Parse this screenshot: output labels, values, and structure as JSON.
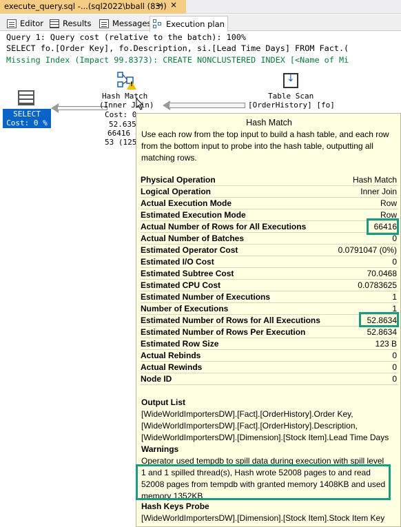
{
  "doc_tab": {
    "title": "execute_query.sql -...(sql2022\\bball (83))",
    "pin": "⊸",
    "close": "×"
  },
  "result_tabs": [
    {
      "label": "Editor"
    },
    {
      "label": "Results"
    },
    {
      "label": "Messages"
    },
    {
      "label": "Execution plan"
    }
  ],
  "query": {
    "line1": "Query 1: Query cost (relative to the batch): 100%",
    "line2": "SELECT fo.[Order Key], fo.Description, si.[Lead Time Days] FROM Fact.(",
    "line3": "Missing Index (Impact 99.8373): CREATE NONCLUSTERED INDEX [<Name of Mi"
  },
  "plan": {
    "select": {
      "name": "SELECT",
      "cost": "Cost: 0 %"
    },
    "hash_match": {
      "name": "Hash Match",
      "sub": "(Inner Join)",
      "cost": "Cost: 0",
      "line1": "52.635",
      "line2": "66416 c",
      "line3": "53 (125"
    },
    "table_scan": {
      "name": "Table Scan",
      "sub": "[OrderHistory] [fo]"
    }
  },
  "tooltip": {
    "title": "Hash Match",
    "description": "Use each row from the top input to build a hash table, and each row from the bottom input to probe into the hash table, outputting all matching rows.",
    "properties": [
      {
        "k": "Physical Operation",
        "v": "Hash Match"
      },
      {
        "k": "Logical Operation",
        "v": "Inner Join"
      },
      {
        "k": "Actual Execution Mode",
        "v": "Row"
      },
      {
        "k": "Estimated Execution Mode",
        "v": "Row"
      },
      {
        "k": "Actual Number of Rows for All Executions",
        "v": "66416"
      },
      {
        "k": "Actual Number of Batches",
        "v": "0"
      },
      {
        "k": "Estimated Operator Cost",
        "v": "0.0791047 (0%)"
      },
      {
        "k": "Estimated I/O Cost",
        "v": "0"
      },
      {
        "k": "Estimated Subtree Cost",
        "v": "70.0468"
      },
      {
        "k": "Estimated CPU Cost",
        "v": "0.0783625"
      },
      {
        "k": "Estimated Number of Executions",
        "v": "1"
      },
      {
        "k": "Number of Executions",
        "v": "1"
      },
      {
        "k": "Estimated Number of Rows for All Executions",
        "v": "52.8634"
      },
      {
        "k": "Estimated Number of Rows Per Execution",
        "v": "52.8634"
      },
      {
        "k": "Estimated Row Size",
        "v": "123 B"
      },
      {
        "k": "Actual Rebinds",
        "v": "0"
      },
      {
        "k": "Actual Rewinds",
        "v": "0"
      },
      {
        "k": "Node ID",
        "v": "0"
      }
    ],
    "output_list_heading": "Output List",
    "output_list": [
      "[WideWorldImportersDW].[Fact].[OrderHistory].Order Key,",
      "[WideWorldImportersDW].[Fact].[OrderHistory].Description,",
      "[WideWorldImportersDW].[Dimension].[Stock Item].Lead Time Days"
    ],
    "warnings_heading": "Warnings",
    "warnings_line1": "Operator used tempdb to spill data during execution with spill level",
    "warnings_rest": "1 and 1 spilled thread(s), Hash wrote 52008 pages to and read 52008 pages from tempdb with granted memory 1408KB and used memory 1352KB",
    "hash_keys_heading": "Hash Keys Probe",
    "hash_keys": "[WideWorldImportersDW].[Dimension].[Stock Item].Stock Item Key"
  },
  "colors": {
    "highlight": "#1b9b84",
    "select_blue": "#0a64c8",
    "tab_active": "#f5cc84",
    "tooltip_bg": "#ffffe1",
    "missing_index": "#0c7a3d"
  }
}
